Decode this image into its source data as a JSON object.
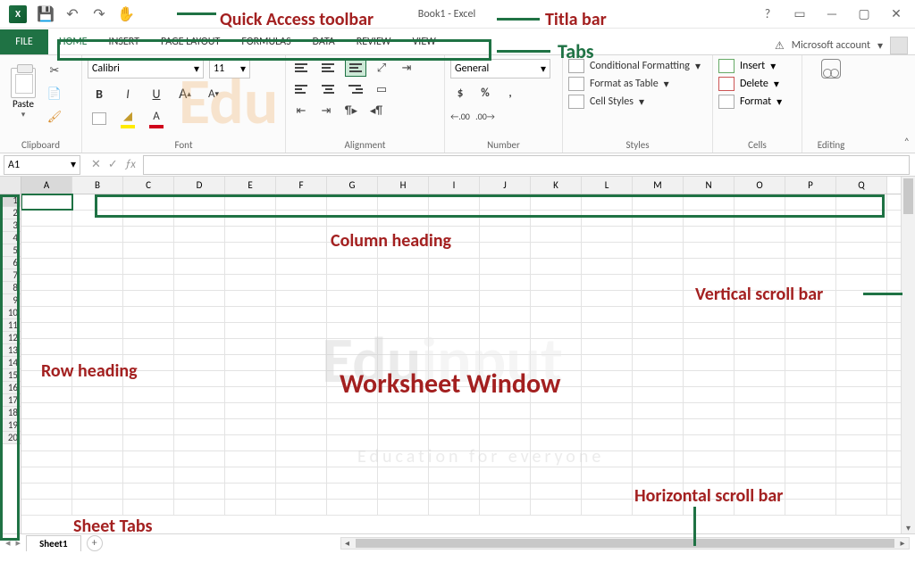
{
  "titlebar": {
    "app_icon_label": "X",
    "document_title": "Book1 - Excel"
  },
  "qat": {
    "save": "💾",
    "undo": "↶",
    "redo": "↷",
    "touch": "✋"
  },
  "win": {
    "help": "?",
    "ribbon_opts": "▭",
    "minimize": "—",
    "restore": "▢",
    "close": "✕"
  },
  "tabs": {
    "file": "FILE",
    "list": [
      "HOME",
      "INSERT",
      "PAGE LAYOUT",
      "FORMULAS",
      "DATA",
      "REVIEW",
      "VIEW"
    ],
    "active": "HOME",
    "account": "Microsoft account",
    "account_warn": "⚠"
  },
  "ribbon": {
    "clipboard": {
      "paste": "Paste",
      "label": "Clipboard",
      "cut": "✂",
      "copy": "📄",
      "painter": "🖌"
    },
    "font": {
      "label": "Font",
      "name": "Calibri",
      "size": "11",
      "bold": "B",
      "italic": "I",
      "underline": "U",
      "grow": "A",
      "shrink": "A",
      "fontcolor": "A"
    },
    "alignment": {
      "label": "Alignment",
      "wrap": "⇥",
      "merge": "▭"
    },
    "number": {
      "label": "Number",
      "format": "General",
      "currency": "$",
      "percent": "%",
      "comma": ",",
      "inc": ".00",
      "dec": ".00"
    },
    "styles": {
      "label": "Styles",
      "cond": "Conditional Formatting",
      "table": "Format as Table",
      "cell": "Cell Styles"
    },
    "cells": {
      "label": "Cells",
      "insert": "Insert",
      "delete": "Delete",
      "format": "Format"
    },
    "editing": {
      "label": "Editing"
    }
  },
  "namebox": {
    "ref": "A1"
  },
  "fx": {
    "cancel": "✕",
    "enter": "✓",
    "fx": "ƒx"
  },
  "columns": [
    "A",
    "B",
    "C",
    "D",
    "E",
    "F",
    "G",
    "H",
    "I",
    "J",
    "K",
    "L",
    "M",
    "N",
    "O",
    "P",
    "Q"
  ],
  "rows": [
    "1",
    "2",
    "3",
    "4",
    "5",
    "6",
    "7",
    "8",
    "9",
    "10",
    "11",
    "12",
    "13",
    "14",
    "15",
    "16",
    "17",
    "18",
    "19",
    "20"
  ],
  "sheet": {
    "name": "Sheet1",
    "add": "+"
  },
  "anno": {
    "qat": "Quick Access toolbar",
    "titlebar": "Titla bar",
    "tabs": "Tabs",
    "colhead": "Column heading",
    "rowhead": "Row heading",
    "worksheet": "Worksheet Window",
    "vscroll": "Vertical scroll bar",
    "hscroll": "Horizontal scroll bar",
    "sheettabs": "Sheet Tabs"
  },
  "watermark": {
    "main1": "Edu",
    "main2": "input",
    "tag": "Education for everyone"
  }
}
